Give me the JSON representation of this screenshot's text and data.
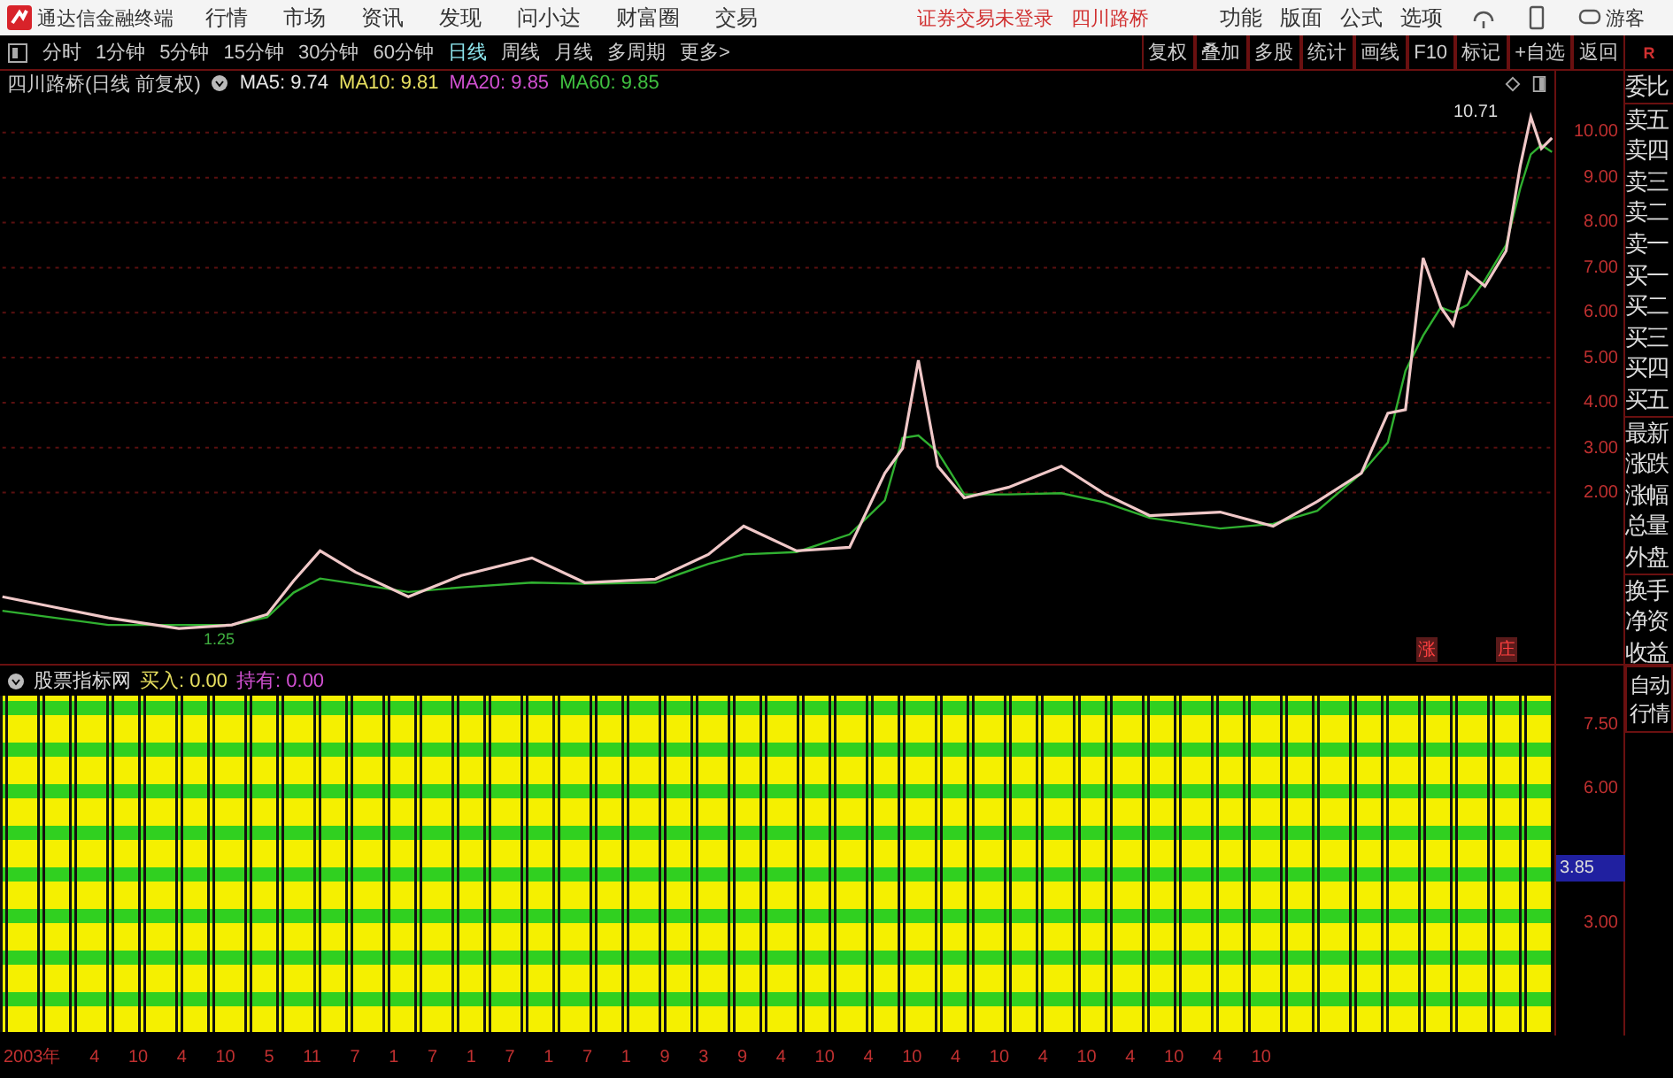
{
  "menubar": {
    "app_title": "通达信金融终端",
    "menus": [
      "行情",
      "市场",
      "资讯",
      "发现",
      "问小达",
      "财富圈",
      "交易"
    ],
    "login_notice": "证券交易未登录",
    "stock_name": "四川路桥",
    "tools": [
      "功能",
      "版面",
      "公式",
      "选项"
    ],
    "user": "游客"
  },
  "period_tabs": [
    {
      "label": "分时",
      "selected": false
    },
    {
      "label": "1分钟",
      "selected": false
    },
    {
      "label": "5分钟",
      "selected": false
    },
    {
      "label": "15分钟",
      "selected": false
    },
    {
      "label": "30分钟",
      "selected": false
    },
    {
      "label": "60分钟",
      "selected": false
    },
    {
      "label": "日线",
      "selected": true
    },
    {
      "label": "周线",
      "selected": false
    },
    {
      "label": "月线",
      "selected": false
    },
    {
      "label": "多周期",
      "selected": false
    }
  ],
  "more_button": "更多>",
  "tool_buttons": [
    "复权",
    "叠加",
    "多股",
    "统计",
    "画线",
    "F10",
    "标记",
    "+自选",
    "返回"
  ],
  "chart": {
    "title": "四川路桥(日线 前复权)",
    "ma": [
      {
        "label": "MA5: 9.74",
        "color": "#e8e8e8"
      },
      {
        "label": "MA10: 9.81",
        "color": "#e8e060"
      },
      {
        "label": "MA20: 9.85",
        "color": "#d050d0"
      },
      {
        "label": "MA60: 9.85",
        "color": "#40c040"
      }
    ],
    "high_label": "10.71",
    "low_label": "1.25",
    "y_labels": [
      "10.00",
      "9.00",
      "8.00",
      "7.00",
      "6.00",
      "5.00",
      "4.00",
      "3.00",
      "2.00"
    ],
    "signals": [
      "涨",
      "庄"
    ]
  },
  "side_panel": {
    "corner": "R",
    "items": [
      "委比",
      "卖五",
      "卖四",
      "卖三",
      "卖二",
      "卖一",
      "买一",
      "买二",
      "买三",
      "买四",
      "买五",
      "最新",
      "涨跌",
      "涨幅",
      "总量",
      "外盘",
      "换手",
      "净资",
      "收益"
    ],
    "auto_button": "自动行情"
  },
  "indicator": {
    "title": "股票指标网",
    "buy": "买入: 0.00",
    "hold": "持有: 0.00",
    "y_labels": [
      "7.50",
      "6.00"
    ],
    "current": "3.85",
    "bottom_label": "3.00"
  },
  "date_axis": [
    "2003年",
    "4",
    "10",
    "4",
    "10",
    "5",
    "11",
    "7",
    "1",
    "7",
    "1",
    "7",
    "1",
    "7",
    "1",
    "9",
    "3",
    "9",
    "4",
    "10",
    "4",
    "10",
    "4",
    "10",
    "4",
    "10",
    "4",
    "10",
    "4",
    "10"
  ]
}
